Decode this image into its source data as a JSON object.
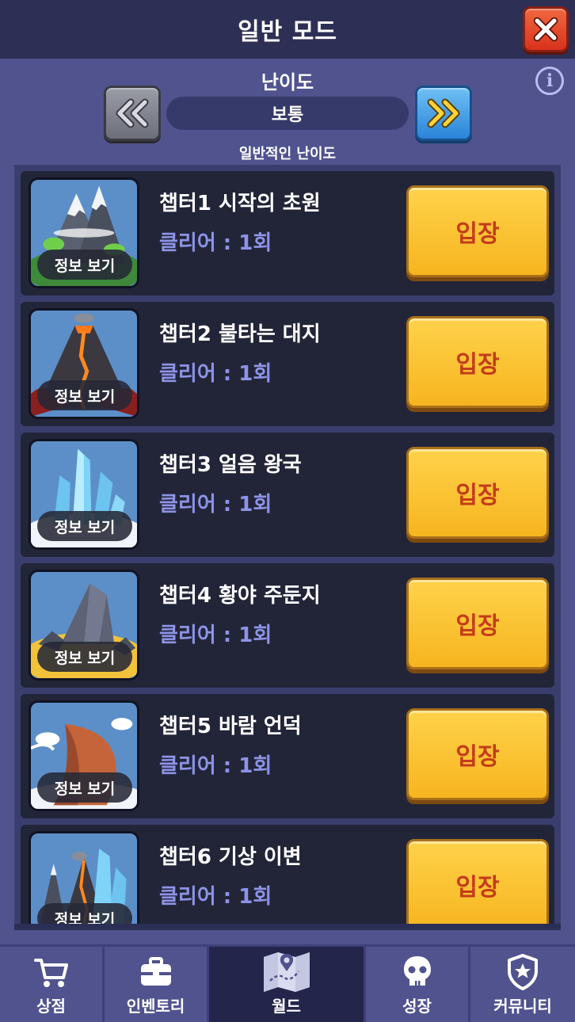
{
  "header": {
    "title": "일반 모드"
  },
  "difficulty": {
    "label": "난이도",
    "current": "보통",
    "description": "일반적인 난이도"
  },
  "chapters": [
    {
      "title": "챕터1 시작의 초원",
      "clear": "클리어 : 1회",
      "info_label": "정보 보기",
      "enter_label": "입장",
      "theme": "mountain"
    },
    {
      "title": "챕터2 불타는 대지",
      "clear": "클리어 : 1회",
      "info_label": "정보 보기",
      "enter_label": "입장",
      "theme": "volcano"
    },
    {
      "title": "챕터3 얼음 왕국",
      "clear": "클리어 : 1회",
      "info_label": "정보 보기",
      "enter_label": "입장",
      "theme": "ice"
    },
    {
      "title": "챕터4 황야 주둔지",
      "clear": "클리어 : 1회",
      "info_label": "정보 보기",
      "enter_label": "입장",
      "theme": "wasteland"
    },
    {
      "title": "챕터5 바람 언덕",
      "clear": "클리어 : 1회",
      "info_label": "정보 보기",
      "enter_label": "입장",
      "theme": "wind"
    },
    {
      "title": "챕터6 기상 이변",
      "clear": "클리어 : 1회",
      "info_label": "정보 보기",
      "enter_label": "입장",
      "theme": "storm"
    }
  ],
  "nav": [
    {
      "label": "상점",
      "icon": "cart-icon",
      "active": false
    },
    {
      "label": "인벤토리",
      "icon": "briefcase-icon",
      "active": false
    },
    {
      "label": "월드",
      "icon": "map-icon",
      "active": true
    },
    {
      "label": "성장",
      "icon": "skull-icon",
      "active": false
    },
    {
      "label": "커뮤니티",
      "icon": "shield-star-icon",
      "active": false
    }
  ],
  "colors": {
    "background": "#50538e",
    "header": "#2d2f55",
    "card": "#222538",
    "enter_button": "#f6b51f",
    "enter_text": "#c43b1c",
    "clear_text": "#8d93e6",
    "close_button": "#e04a2c"
  }
}
